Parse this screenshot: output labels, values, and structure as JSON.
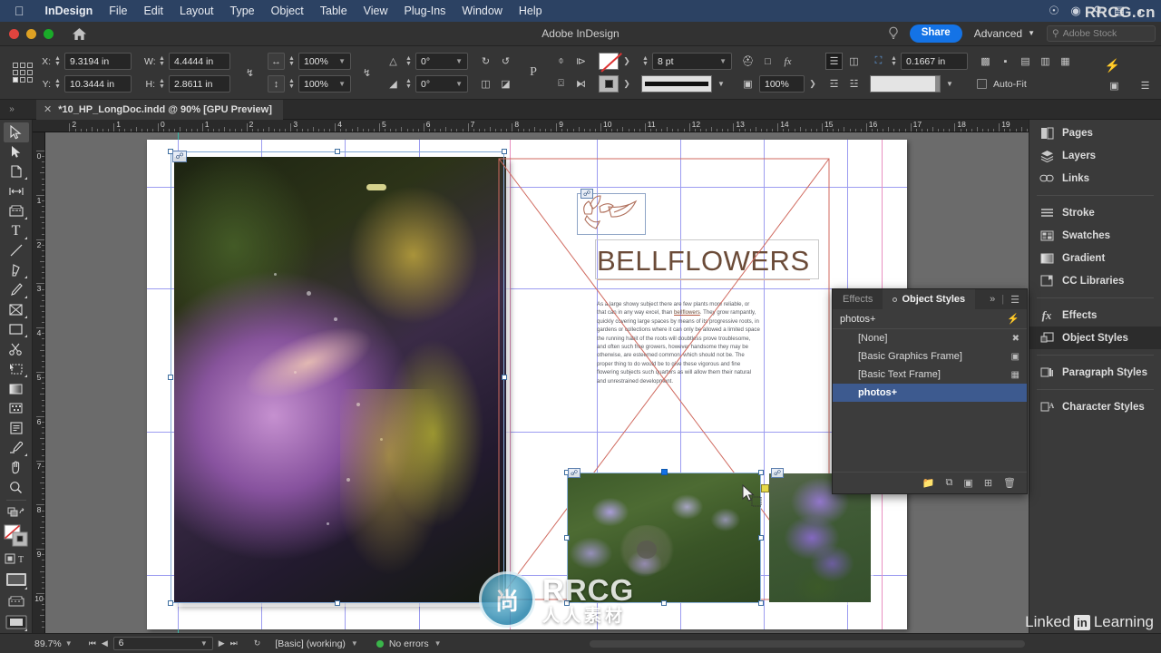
{
  "macos_menu": {
    "apple": "apple-logo",
    "items": [
      "InDesign",
      "File",
      "Edit",
      "Layout",
      "Type",
      "Object",
      "Table",
      "View",
      "Plug-Ins",
      "Window",
      "Help"
    ],
    "status_icons": [
      "creative-cloud-icon",
      "control-center-icon",
      "spotlight-icon",
      "screen-record-icon",
      "siri-icon"
    ],
    "watermark": "RRCG.cn"
  },
  "titlebar": {
    "title": "Adobe InDesign",
    "home_icon": "home-icon",
    "bulb_icon": "lightbulb-icon",
    "share_label": "Share",
    "workspace_label": "Advanced",
    "stock_placeholder": "Adobe Stock",
    "stock_value": ""
  },
  "control_bar": {
    "x_label": "X:",
    "x_value": "9.3194 in",
    "y_label": "Y:",
    "y_value": "10.3444 in",
    "w_label": "W:",
    "w_value": "4.4444 in",
    "h_label": "H:",
    "h_value": "2.8611 in",
    "scale_x": "100%",
    "scale_y": "100%",
    "rotate_value": "0°",
    "shear_value": "0°",
    "stroke_weight": "8 pt",
    "corner_radius": "0.1667 in",
    "opacity": "100%",
    "autofit_label": "Auto-Fit",
    "constrain_icon": "constrain-proportions-icon",
    "reference_point": "bottom-left"
  },
  "document_tab": {
    "close_icon": "close-icon",
    "label": "*10_HP_LongDoc.indd @ 90% [GPU Preview]"
  },
  "rulers": {
    "horizontal": [
      "2",
      "1",
      "0",
      "1",
      "2",
      "3",
      "4",
      "5",
      "6",
      "7",
      "8",
      "9",
      "10",
      "11",
      "12",
      "13",
      "14",
      "15",
      "16",
      "17",
      "18",
      "19"
    ],
    "vertical": [
      "0",
      "1",
      "2",
      "3",
      "4",
      "5",
      "6",
      "7",
      "8",
      "9",
      "10",
      "1"
    ]
  },
  "toolbar": {
    "tools": [
      {
        "name": "selection-tool",
        "glyph": "▷",
        "selected": true
      },
      {
        "name": "direct-selection-tool",
        "glyph": "▶",
        "selected": false
      },
      {
        "name": "page-tool",
        "glyph": "⬚",
        "selected": false
      },
      {
        "name": "gap-tool",
        "glyph": "↔",
        "selected": false
      },
      {
        "name": "content-collector-tool",
        "glyph": "☲",
        "selected": false
      },
      {
        "name": "type-tool",
        "glyph": "T",
        "selected": false
      },
      {
        "name": "line-tool",
        "glyph": "╱",
        "selected": false
      },
      {
        "name": "pen-tool",
        "glyph": "✒",
        "selected": false
      },
      {
        "name": "pencil-tool",
        "glyph": "✎",
        "selected": false
      },
      {
        "name": "frame-tool",
        "glyph": "⊠",
        "selected": false
      },
      {
        "name": "rectangle-tool",
        "glyph": "▭",
        "selected": false
      },
      {
        "name": "scissors-tool",
        "glyph": "✂",
        "selected": false
      },
      {
        "name": "free-transform-tool",
        "glyph": "⬚",
        "selected": false
      },
      {
        "name": "gradient-swatch-tool",
        "glyph": "◧",
        "selected": false
      },
      {
        "name": "gradient-feather-tool",
        "glyph": "▒",
        "selected": false
      },
      {
        "name": "note-tool",
        "glyph": "☰",
        "selected": false
      },
      {
        "name": "eyedropper-tool",
        "glyph": "✐",
        "selected": false
      },
      {
        "name": "hand-tool",
        "glyph": "✋",
        "selected": false
      },
      {
        "name": "zoom-tool",
        "glyph": "⚲",
        "selected": false
      }
    ],
    "fill_stroke": {
      "name": "fill-stroke-swatches",
      "fill": "none",
      "stroke": "black"
    },
    "screen_mode": "normal-view-mode",
    "apply_none": "apply-none-icon"
  },
  "canvas": {
    "page_left_name": "left-page",
    "page_right_name": "right-page",
    "selected_frame": "bottom-center-photo-frame",
    "cursor": "selection-arrow-cursor"
  },
  "document": {
    "headline": "BELLFLOWERS",
    "body_lines": [
      "As a large showy subject there are few plants more reliable, or",
      "that can in any way excel, than bellflowers. They grow rampantly,",
      "quickly covering large spaces by means of its progressive roots, in",
      "gardens or collections where it can only be allowed a limited space",
      "the running habit of the roots will doubtless prove troublesome,",
      "and often such free growers, however handsome they may be",
      "otherwise, are esteemed common, which should not be. The",
      "proper thing to do would be to give these vigorous and fine",
      "flowering subjects such quarters as will allow them their natural",
      "and unrestrained development."
    ],
    "link_badge": "linked-content-icon"
  },
  "dock": {
    "groups": [
      [
        {
          "label": "Pages",
          "icon": "pages-icon",
          "selected": false
        },
        {
          "label": "Layers",
          "icon": "layers-icon",
          "selected": false
        },
        {
          "label": "Links",
          "icon": "links-icon",
          "selected": false
        }
      ],
      [
        {
          "label": "Stroke",
          "icon": "stroke-icon",
          "selected": false
        },
        {
          "label": "Swatches",
          "icon": "swatches-icon",
          "selected": false
        },
        {
          "label": "Gradient",
          "icon": "gradient-icon",
          "selected": false
        },
        {
          "label": "CC Libraries",
          "icon": "cc-libraries-icon",
          "selected": false
        }
      ],
      [
        {
          "label": "Effects",
          "icon": "fx-icon",
          "selected": false
        },
        {
          "label": "Object Styles",
          "icon": "object-styles-icon",
          "selected": true
        }
      ],
      [
        {
          "label": "Paragraph Styles",
          "icon": "paragraph-styles-icon",
          "selected": false
        }
      ],
      [
        {
          "label": "Character Styles",
          "icon": "character-styles-icon",
          "selected": false
        }
      ]
    ]
  },
  "object_styles_panel": {
    "tabs": [
      {
        "label": "Effects",
        "active": false
      },
      {
        "label": "Object Styles",
        "active": true
      }
    ],
    "collapse_icon": "double-chevron-right-icon",
    "menu_icon": "panel-menu-icon",
    "current_style": "photos+",
    "clear_overrides_icon": "clear-overrides-icon",
    "rows": [
      {
        "label": "[None]",
        "icon": "none-style-icon",
        "selected": false
      },
      {
        "label": "[Basic Graphics Frame]",
        "icon": "graphics-frame-icon",
        "selected": false
      },
      {
        "label": "[Basic Text Frame]",
        "icon": "text-frame-icon",
        "selected": false
      },
      {
        "label": "photos+",
        "icon": "",
        "selected": true
      }
    ],
    "footer_icons": [
      "new-style-group-icon",
      "clear-attributes-icon",
      "clear-overrides-icon",
      "new-style-icon",
      "delete-style-icon"
    ]
  },
  "status_bar": {
    "zoom_value": "89.7%",
    "first_page_icon": "first-page-icon",
    "prev_page_icon": "prev-page-icon",
    "page_value": "6",
    "next_page_icon": "next-page-icon",
    "last_page_icon": "last-page-icon",
    "preflight_icon": "preflight-icon",
    "preflight_profile": "[Basic] (working)",
    "errors_label": "No errors"
  },
  "watermarks": {
    "rrcg_main": "RRCG",
    "rrcg_sub": "人人素材",
    "rrcg_corner": "RRCG.cn",
    "linkedin_pre": "Linked",
    "linkedin_in": "in",
    "linkedin_post": "Learning"
  },
  "colors": {
    "menubar": "#2c4263",
    "accent_blue": "#1473e6",
    "panel_bg": "#3c3c3c",
    "selection_blue": "#3d5a8f",
    "status_green": "#3ab54a",
    "guide": "#9c9cf0",
    "margin": "#e98fc0",
    "headline": "#6b4b38"
  }
}
